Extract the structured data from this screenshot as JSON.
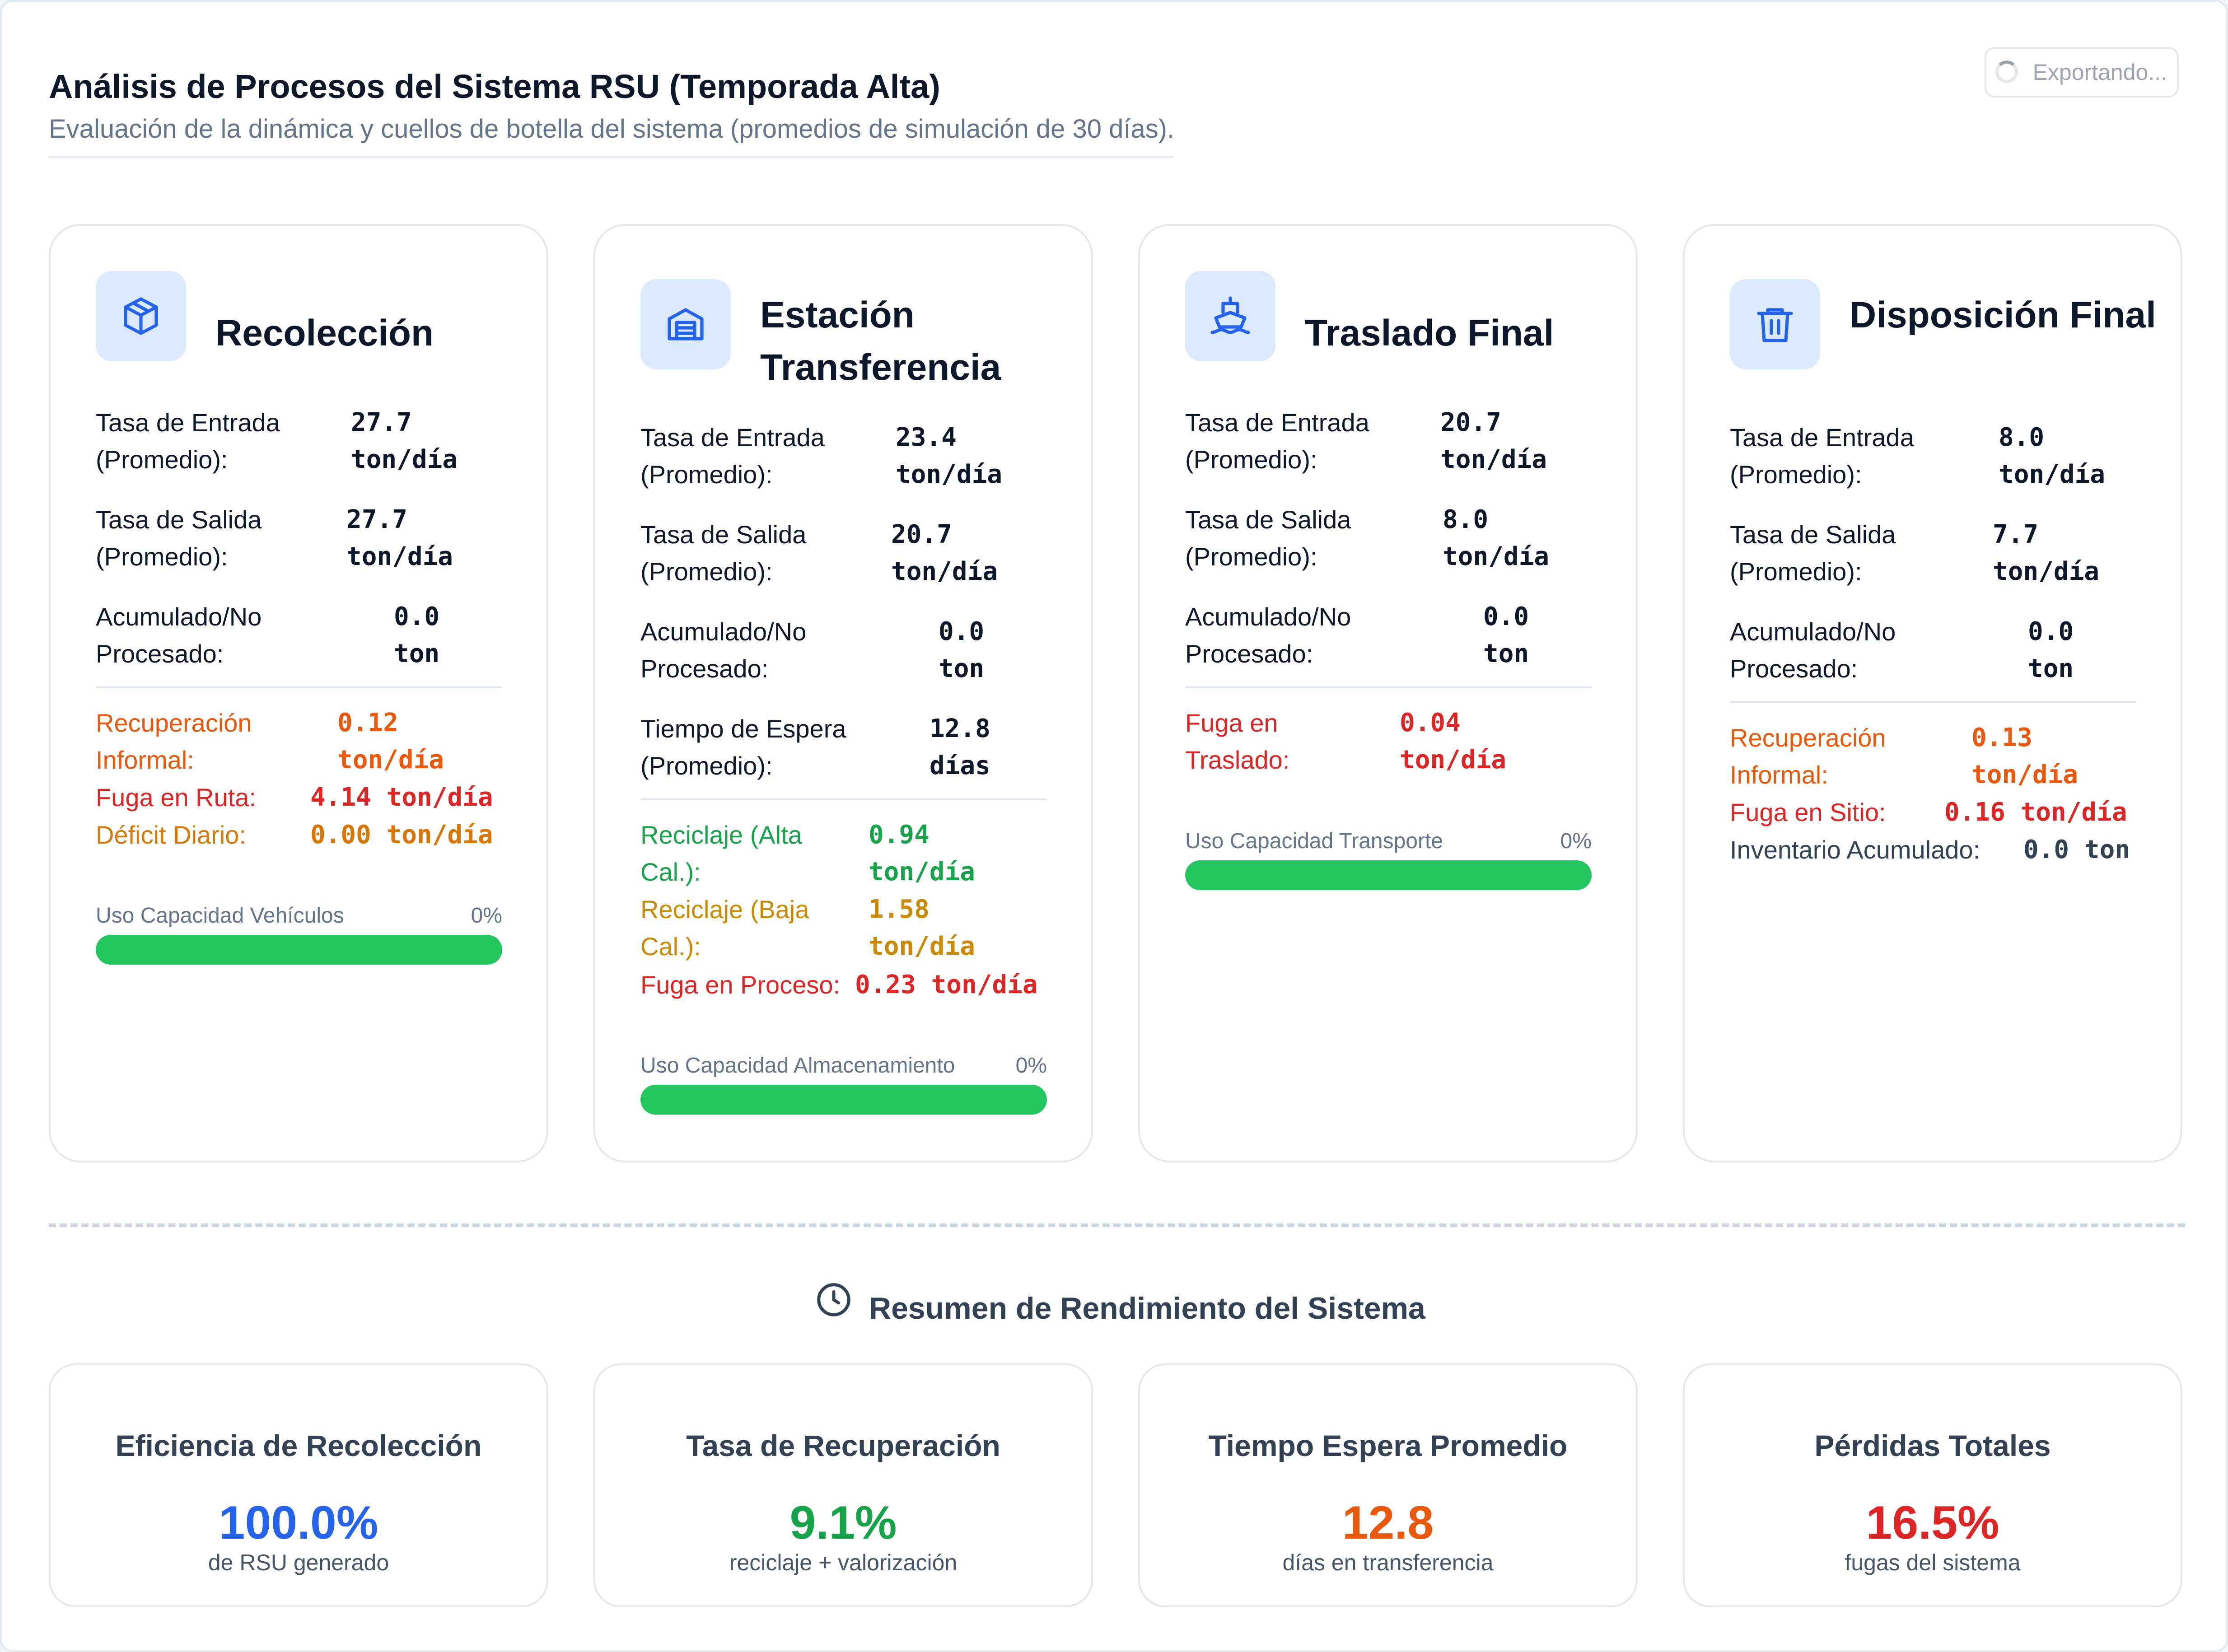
{
  "header": {
    "title": "Análisis de Procesos del Sistema RSU (Temporada Alta)",
    "subtitle": "Evaluación de la dinámica y cuellos de botella del sistema (promedios de simulación de 30 días).",
    "export_label": "Exportando..."
  },
  "colors": {
    "accent_blue": "#2563eb",
    "icon_bg": "#dbeafe",
    "success_green": "#22c55e",
    "danger_red": "#dc2626",
    "warning_orange": "#ea580c"
  },
  "stages": [
    {
      "title": "Recolección",
      "icon": "box-icon",
      "rows": [
        {
          "label": "Tasa de Entrada (Promedio):",
          "value": "27.7 ton/día"
        },
        {
          "label": "Tasa de Salida (Promedio):",
          "value": "27.7 ton/día"
        },
        {
          "label": "Acumulado/No Procesado:",
          "value": "0.0 ton"
        }
      ],
      "extras": [
        {
          "label": "Recuperación Informal:",
          "value": "0.12 ton/día"
        },
        {
          "label": "Fuga en Ruta:",
          "value": "4.14 ton/día"
        },
        {
          "label": "Déficit Diario:",
          "value": "0.00 ton/día"
        }
      ],
      "bar": {
        "label": "Uso Capacidad Vehículos",
        "pct_label": "0%",
        "fill_fraction": 1.0
      }
    },
    {
      "title": "Estación Transferencia",
      "icon": "warehouse-icon",
      "rows": [
        {
          "label": "Tasa de Entrada (Promedio):",
          "value": "23.4 ton/día"
        },
        {
          "label": "Tasa de Salida (Promedio):",
          "value": "20.7 ton/día"
        },
        {
          "label": "Acumulado/No Procesado:",
          "value": "0.0 ton"
        },
        {
          "label": "Tiempo de Espera (Promedio):",
          "value": "12.8 días"
        }
      ],
      "extras": [
        {
          "label": "Reciclaje (Alta Cal.):",
          "value": "0.94 ton/día"
        },
        {
          "label": "Reciclaje (Baja Cal.):",
          "value": "1.58 ton/día"
        },
        {
          "label": "Fuga en Proceso:",
          "value": "0.23 ton/día"
        }
      ],
      "bar": {
        "label": "Uso Capacidad Almacenamiento",
        "pct_label": "0%",
        "fill_fraction": 1.0
      }
    },
    {
      "title": "Traslado Final",
      "icon": "ship-icon",
      "rows": [
        {
          "label": "Tasa de Entrada (Promedio):",
          "value": "20.7 ton/día"
        },
        {
          "label": "Tasa de Salida (Promedio):",
          "value": "8.0 ton/día"
        },
        {
          "label": "Acumulado/No Procesado:",
          "value": "0.0 ton"
        }
      ],
      "extras": [
        {
          "label": "Fuga en Traslado:",
          "value": "0.04 ton/día"
        }
      ],
      "bar": {
        "label": "Uso Capacidad Transporte",
        "pct_label": "0%",
        "fill_fraction": 1.0
      }
    },
    {
      "title": "Disposición Final",
      "icon": "trash-icon",
      "rows": [
        {
          "label": "Tasa de Entrada (Promedio):",
          "value": "8.0 ton/día"
        },
        {
          "label": "Tasa de Salida (Promedio):",
          "value": "7.7 ton/día"
        },
        {
          "label": "Acumulado/No Procesado:",
          "value": "0.0 ton"
        }
      ],
      "extras": [
        {
          "label": "Recuperación Informal:",
          "value": "0.13 ton/día"
        },
        {
          "label": "Fuga en Sitio:",
          "value": "0.16 ton/día"
        },
        {
          "label": "Inventario Acumulado:",
          "value": "0.0 ton"
        }
      ]
    }
  ],
  "summary": {
    "title": "Resumen de Rendimiento del Sistema",
    "cards": [
      {
        "title": "Eficiencia de Recolección",
        "value": "100.0%",
        "sub": "de RSU generado",
        "color": "#2563eb"
      },
      {
        "title": "Tasa de Recuperación",
        "value": "9.1%",
        "sub": "reciclaje + valorización",
        "color": "#16a34a"
      },
      {
        "title": "Tiempo Espera Promedio",
        "value": "12.8",
        "sub": "días en transferencia",
        "color": "#ea580c"
      },
      {
        "title": "Pérdidas Totales",
        "value": "16.5%",
        "sub": "fugas del sistema",
        "color": "#dc2626"
      }
    ]
  }
}
